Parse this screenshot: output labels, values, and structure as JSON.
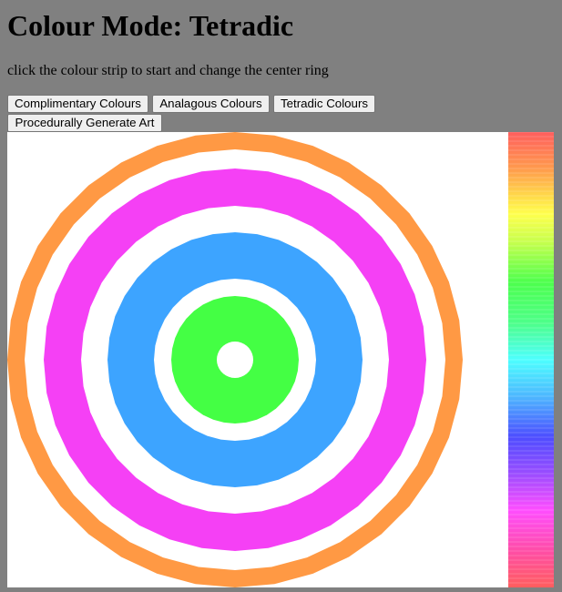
{
  "header": {
    "title": "Colour Mode: Tetradic",
    "hint": "click the colour strip to start and change the center ring"
  },
  "buttons": {
    "complimentary": "Complimentary Colours",
    "analagous": "Analagous Colours",
    "tetradic": "Tetradic Colours",
    "procedural": "Procedurally Generate Art"
  },
  "canvas": {
    "background": "#ffffff",
    "rings": [
      {
        "name": "outer-ring",
        "color": "#ff9944"
      },
      {
        "name": "second-ring",
        "color": "#f540f5"
      },
      {
        "name": "third-ring",
        "color": "#3da4ff"
      },
      {
        "name": "center-ring",
        "color": "#44ff44"
      }
    ]
  },
  "page": {
    "background": "#808080"
  }
}
